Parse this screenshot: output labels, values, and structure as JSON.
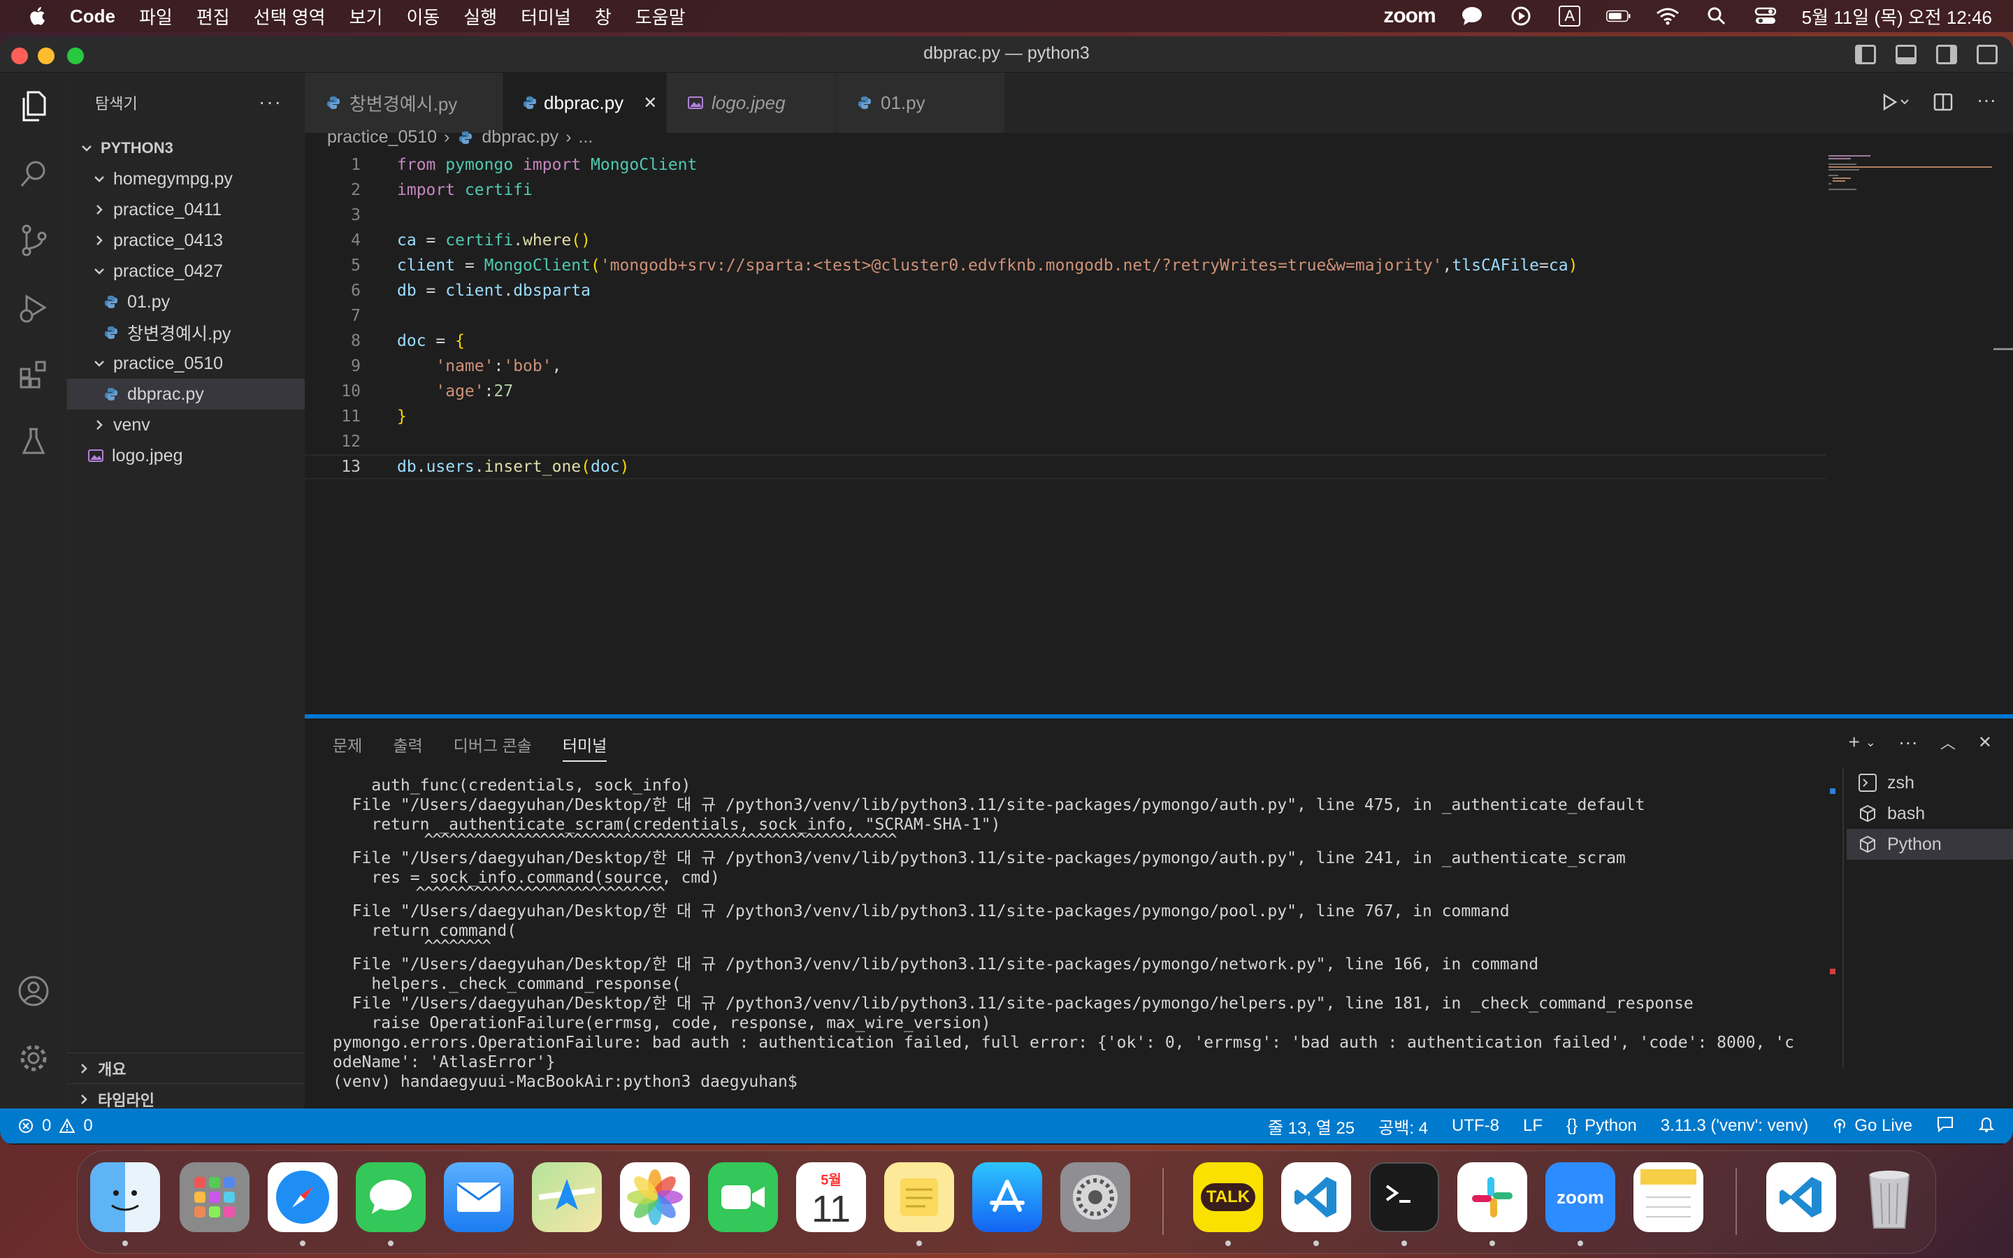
{
  "menubar": {
    "app": "Code",
    "items": [
      "파일",
      "편집",
      "선택 영역",
      "보기",
      "이동",
      "실행",
      "터미널",
      "창",
      "도움말"
    ],
    "zoom_label": "zoom",
    "input_indicator": "A",
    "clock": "5월 11일 (목) 오전 12:46"
  },
  "window": {
    "title": "dbprac.py — python3"
  },
  "sidebar": {
    "title": "탐색기",
    "root": "PYTHON3",
    "items": [
      {
        "label": "homegympg.py"
      },
      {
        "label": "practice_0411"
      },
      {
        "label": "practice_0413"
      },
      {
        "label": "practice_0427"
      },
      {
        "label": "01.py"
      },
      {
        "label": "창변경예시.py"
      },
      {
        "label": "practice_0510"
      },
      {
        "label": "dbprac.py"
      },
      {
        "label": "venv"
      },
      {
        "label": "logo.jpeg"
      }
    ],
    "outline": "개요",
    "timeline": "타임라인"
  },
  "tabs": [
    {
      "label": "창변경예시.py"
    },
    {
      "label": "dbprac.py"
    },
    {
      "label": "logo.jpeg"
    },
    {
      "label": "01.py"
    }
  ],
  "breadcrumb": {
    "folder": "practice_0510",
    "file": "dbprac.py",
    "more": "..."
  },
  "editor": {
    "line_numbers": [
      "1",
      "2",
      "3",
      "4",
      "5",
      "6",
      "7",
      "8",
      "9",
      "10",
      "11",
      "12",
      "13"
    ],
    "lines": {
      "l1": {
        "from": "from",
        "module": "pymongo",
        "import": "import",
        "name": "MongoClient"
      },
      "l2": {
        "import": "import",
        "name": "certifi"
      },
      "l4": {
        "var": "ca",
        "eq": " = ",
        "obj": "certifi",
        "dot": ".",
        "fn": "where",
        "parens": "()"
      },
      "l5": {
        "var": "client",
        "eq": " = ",
        "cls": "MongoClient",
        "open": "(",
        "uri": "'mongodb+srv://sparta:<test>@cluster0.edvfknb.mongodb.net/?retryWrites=true&w=majority'",
        "comma": ",",
        "kwarg": "tlsCAFile",
        "assign": "=",
        "val": "ca",
        "close": ")"
      },
      "l6": {
        "var": "db",
        "eq": " = ",
        "obj": "client",
        "dot": ".",
        "attr": "dbsparta"
      },
      "l8": {
        "var": "doc",
        "eq": " = ",
        "brace": "{"
      },
      "l9": {
        "key": "'name'",
        "colon": ":",
        "val": "'bob'",
        "comma": ","
      },
      "l10": {
        "key": "'age'",
        "colon": ":",
        "val": "27"
      },
      "l11": {
        "brace": "}"
      },
      "l13": {
        "obj": "db",
        "d1": ".",
        "coll": "users",
        "d2": ".",
        "fn": "insert_one",
        "open": "(",
        "arg": "doc",
        "close": ")"
      }
    }
  },
  "panel": {
    "tabs": [
      "문제",
      "출력",
      "디버그 콘솔",
      "터미널"
    ],
    "terminal_lines": [
      "    auth_func(credentials, sock_info)",
      "  File \"/Users/daegyuhan/Desktop/한 대 규 /python3/venv/lib/python3.11/site-packages/pymongo/auth.py\", line 475, in _authenticate_default",
      "    return _authenticate_scram(credentials, sock_info, \"SCRAM-SHA-1\")",
      "           ^^^^^^^^^^^^^^^^^^^^^^^^^^^^^^^^^^^^^^^^^^^^^^^^^^^^^^^^^",
      "  File \"/Users/daegyuhan/Desktop/한 대 규 /python3/venv/lib/python3.11/site-packages/pymongo/auth.py\", line 241, in _authenticate_scram",
      "    res = sock_info.command(source, cmd)",
      "          ^^^^^^^^^^^^^^^^^^^^^^^^^^^^^^",
      "  File \"/Users/daegyuhan/Desktop/한 대 규 /python3/venv/lib/python3.11/site-packages/pymongo/pool.py\", line 767, in command",
      "    return command(",
      "           ^^^^^^^^",
      "  File \"/Users/daegyuhan/Desktop/한 대 규 /python3/venv/lib/python3.11/site-packages/pymongo/network.py\", line 166, in command",
      "    helpers._check_command_response(",
      "  File \"/Users/daegyuhan/Desktop/한 대 규 /python3/venv/lib/python3.11/site-packages/pymongo/helpers.py\", line 181, in _check_command_response",
      "    raise OperationFailure(errmsg, code, response, max_wire_version)",
      "pymongo.errors.OperationFailure: bad auth : authentication failed, full error: {'ok': 0, 'errmsg': 'bad auth : authentication failed', 'code': 8000, 'c",
      "odeName': 'AtlasError'}",
      "(venv) handaegyuui-MacBookAir:python3 daegyuhan$"
    ],
    "terminals": [
      "zsh",
      "bash",
      "Python"
    ]
  },
  "statusbar": {
    "errors": "0",
    "warnings": "0",
    "position": "줄 13, 열 25",
    "spaces": "공백: 4",
    "encoding": "UTF-8",
    "eol": "LF",
    "language": "Python",
    "interpreter": "3.11.3 ('venv': venv)",
    "golive": "Go Live"
  },
  "dock": {
    "calendar_month": "5월",
    "calendar_day": "11",
    "kakao_label": "TALK",
    "zoom_label": "zoom"
  }
}
